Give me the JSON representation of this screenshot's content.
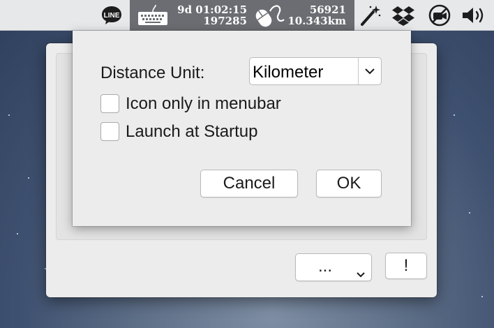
{
  "menubar": {
    "uptime": "9d 01:02:15",
    "keystrokes": "197285",
    "clicks": "56921",
    "distance": "10.343km"
  },
  "sheet": {
    "distance_unit_label": "Distance Unit:",
    "distance_unit_value": "Kilometer",
    "icon_only_label": "Icon only in menubar",
    "launch_label": "Launch at Startup",
    "cancel_label": "Cancel",
    "ok_label": "OK"
  },
  "window": {
    "more_button_label": "...",
    "alert_button_label": "!"
  },
  "icons": {
    "line": "line-app-icon",
    "keyboard": "keyboard-icon",
    "mouse": "mouse-icon",
    "magic_wand": "magic-wand-icon",
    "dropbox": "dropbox-icon",
    "no_camera": "no-camera-icon",
    "volume": "volume-icon"
  }
}
